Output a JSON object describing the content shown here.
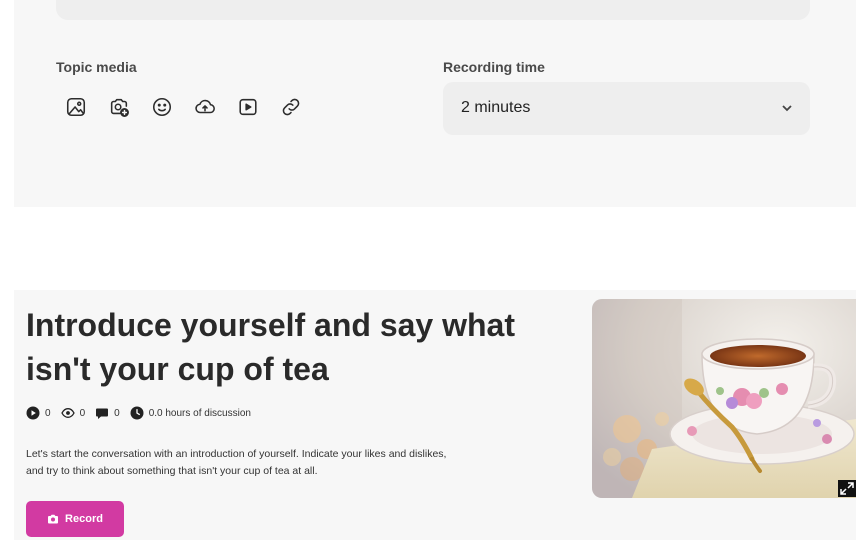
{
  "editor": {
    "topic_media_label": "Topic media",
    "recording_time_label": "Recording time",
    "recording_time_value": "2 minutes",
    "media_icons": [
      "image-icon",
      "camera-add-icon",
      "smiley-icon",
      "cloud-upload-icon",
      "video-play-icon",
      "link-icon"
    ]
  },
  "topic": {
    "title": "Introduce yourself and say what isn't your cup of tea",
    "stats": {
      "videos": "0",
      "views": "0",
      "comments": "0",
      "hours": "0.0 hours of discussion"
    },
    "description": "Let's start the conversation with an introduction of yourself. Indicate your likes and dislikes, and try to think about something that isn't your cup of tea at all.",
    "record_label": "Record",
    "image_subject": "teacup-photo"
  },
  "colors": {
    "accent": "#d23aa2",
    "panel_bg": "#f7f7f7",
    "select_bg": "#eeeeee"
  }
}
